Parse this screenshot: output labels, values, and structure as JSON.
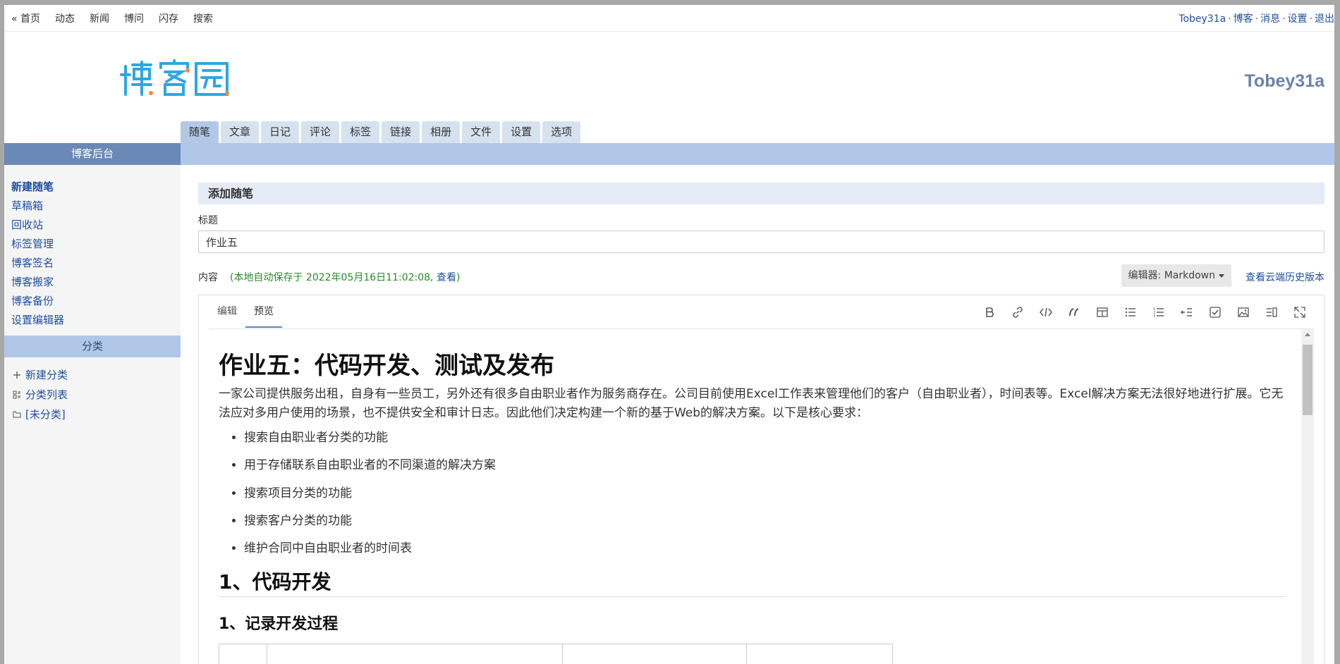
{
  "topnav": [
    "« 首页",
    "动态",
    "新闻",
    "博问",
    "闪存",
    "搜索"
  ],
  "user_links": [
    "Tobey31a",
    "博客",
    "消息",
    "设置",
    "退出"
  ],
  "blog_name": "Tobey31a",
  "logo_text": "博客园",
  "main_tabs": [
    "随笔",
    "文章",
    "日记",
    "评论",
    "标签",
    "链接",
    "相册",
    "文件",
    "设置",
    "选项"
  ],
  "active_tab": "随笔",
  "sidebar": {
    "header": "博客后台",
    "links": [
      "新建随笔",
      "草稿箱",
      "回收站",
      "标签管理",
      "博客签名",
      "博客搬家",
      "博客备份",
      "设置编辑器"
    ],
    "category_header": "分类",
    "categories": [
      "新建分类",
      "分类列表",
      "[未分类]"
    ]
  },
  "form": {
    "section_title": "添加随笔",
    "title_label": "标题",
    "title_value": "作业五",
    "content_label": "内容",
    "autosave_text": "(本地自动保存于 2022年05月16日11:02:08,",
    "autosave_link": "查看",
    "autosave_close": ")",
    "editor_select": "编辑器: Markdown",
    "history_link": "查看云端历史版本"
  },
  "editor": {
    "tabs": [
      "编辑",
      "预览"
    ],
    "active": "预览",
    "tools": [
      "bold-icon",
      "link-icon",
      "code-icon",
      "quote-icon",
      "table-icon",
      "bullet-list-icon",
      "numbered-list-icon",
      "indent-icon",
      "checkbox-icon",
      "image-icon",
      "split-view-icon",
      "fullscreen-icon"
    ]
  },
  "preview": {
    "h1": "作业五：代码开发、测试及发布",
    "intro": "一家公司提供服务出租，自身有一些员工，另外还有很多自由职业者作为服务商存在。公司目前使用Excel工作表来管理他们的客户（自由职业者），时间表等。Excel解决方案无法很好地进行扩展。它无法应对多用户使用的场景，也不提供安全和审计日志。因此他们决定构建一个新的基于Web的解决方案。以下是核心要求：",
    "bullets": [
      "搜索自由职业者分类的功能",
      "用于存储联系自由职业者的不同渠道的解决方案",
      "搜索项目分类的功能",
      "搜索客户分类的功能",
      "维护合同中自由职业者的时间表"
    ],
    "h2": "1、代码开发",
    "h3": "1、记录开发过程"
  }
}
